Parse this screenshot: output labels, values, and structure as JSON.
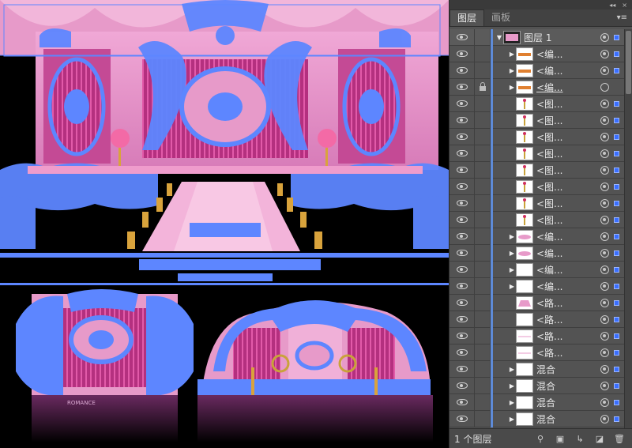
{
  "panel": {
    "tabs": [
      {
        "label": "图层",
        "active": true
      },
      {
        "label": "画板",
        "active": false
      }
    ],
    "top_controls": [
      "◂◂",
      "×"
    ],
    "menu_icon": "panel-menu-icon"
  },
  "layers": [
    {
      "name": "图层 1",
      "type": "layer",
      "expanded": true,
      "locked": false,
      "thumb": "composite",
      "target": "filled",
      "selected": true
    },
    {
      "name": "<编...",
      "type": "group",
      "locked": false,
      "thumb": "text-orange",
      "target": "filled",
      "selected": true
    },
    {
      "name": "<编...",
      "type": "group",
      "locked": false,
      "thumb": "text-orange",
      "target": "filled",
      "selected": true
    },
    {
      "name": "<编...",
      "type": "group",
      "locked": true,
      "thumb": "text-orange",
      "target": "empty",
      "selected": false,
      "underline": true
    },
    {
      "name": "<图...",
      "type": "item",
      "locked": false,
      "thumb": "lamp",
      "target": "filled",
      "selected": true
    },
    {
      "name": "<图...",
      "type": "item",
      "locked": false,
      "thumb": "lamp",
      "target": "filled",
      "selected": true
    },
    {
      "name": "<图...",
      "type": "item",
      "locked": false,
      "thumb": "lamp",
      "target": "filled",
      "selected": true
    },
    {
      "name": "<图...",
      "type": "item",
      "locked": false,
      "thumb": "lamp",
      "target": "filled",
      "selected": true
    },
    {
      "name": "<图...",
      "type": "item",
      "locked": false,
      "thumb": "lamp",
      "target": "filled",
      "selected": true
    },
    {
      "name": "<图...",
      "type": "item",
      "locked": false,
      "thumb": "lamp",
      "target": "filled",
      "selected": true
    },
    {
      "name": "<图...",
      "type": "item",
      "locked": false,
      "thumb": "lamp",
      "target": "filled",
      "selected": true
    },
    {
      "name": "<图...",
      "type": "item",
      "locked": false,
      "thumb": "lamp",
      "target": "filled",
      "selected": true
    },
    {
      "name": "<编...",
      "type": "group",
      "locked": false,
      "thumb": "pink-shape",
      "target": "filled",
      "selected": true
    },
    {
      "name": "<编...",
      "type": "group",
      "locked": false,
      "thumb": "pink-shape",
      "target": "filled",
      "selected": true
    },
    {
      "name": "<编...",
      "type": "group",
      "locked": false,
      "thumb": "blank",
      "target": "filled",
      "selected": true
    },
    {
      "name": "<编...",
      "type": "group",
      "locked": false,
      "thumb": "blank",
      "target": "filled",
      "selected": true
    },
    {
      "name": "<路...",
      "type": "item",
      "locked": false,
      "thumb": "pink-fill",
      "target": "filled",
      "selected": true
    },
    {
      "name": "<路...",
      "type": "item",
      "locked": false,
      "thumb": "blank",
      "target": "filled",
      "selected": true
    },
    {
      "name": "<路...",
      "type": "item",
      "locked": false,
      "thumb": "line",
      "target": "filled",
      "selected": true
    },
    {
      "name": "<路...",
      "type": "item",
      "locked": false,
      "thumb": "line",
      "target": "filled",
      "selected": true
    },
    {
      "name": "混合",
      "type": "group",
      "locked": false,
      "thumb": "blank",
      "target": "filled",
      "selected": true
    },
    {
      "name": "混合",
      "type": "group",
      "locked": false,
      "thumb": "blank",
      "target": "filled",
      "selected": true
    },
    {
      "name": "混合",
      "type": "group",
      "locked": false,
      "thumb": "blank",
      "target": "filled",
      "selected": true
    },
    {
      "name": "混合",
      "type": "group",
      "locked": false,
      "thumb": "blank",
      "target": "filled",
      "selected": true
    }
  ],
  "footer": {
    "count_label": "1 个图层",
    "icons": [
      "search-icon",
      "clipping-mask-icon",
      "sublayer-icon",
      "new-layer-icon",
      "delete-icon"
    ]
  },
  "colors": {
    "panel_bg": "#535353",
    "selection_blue": "#3a6fff",
    "canvas_pink": "#e89ac8",
    "magenta": "#b02b77",
    "outline_blue": "#5d86ff"
  }
}
